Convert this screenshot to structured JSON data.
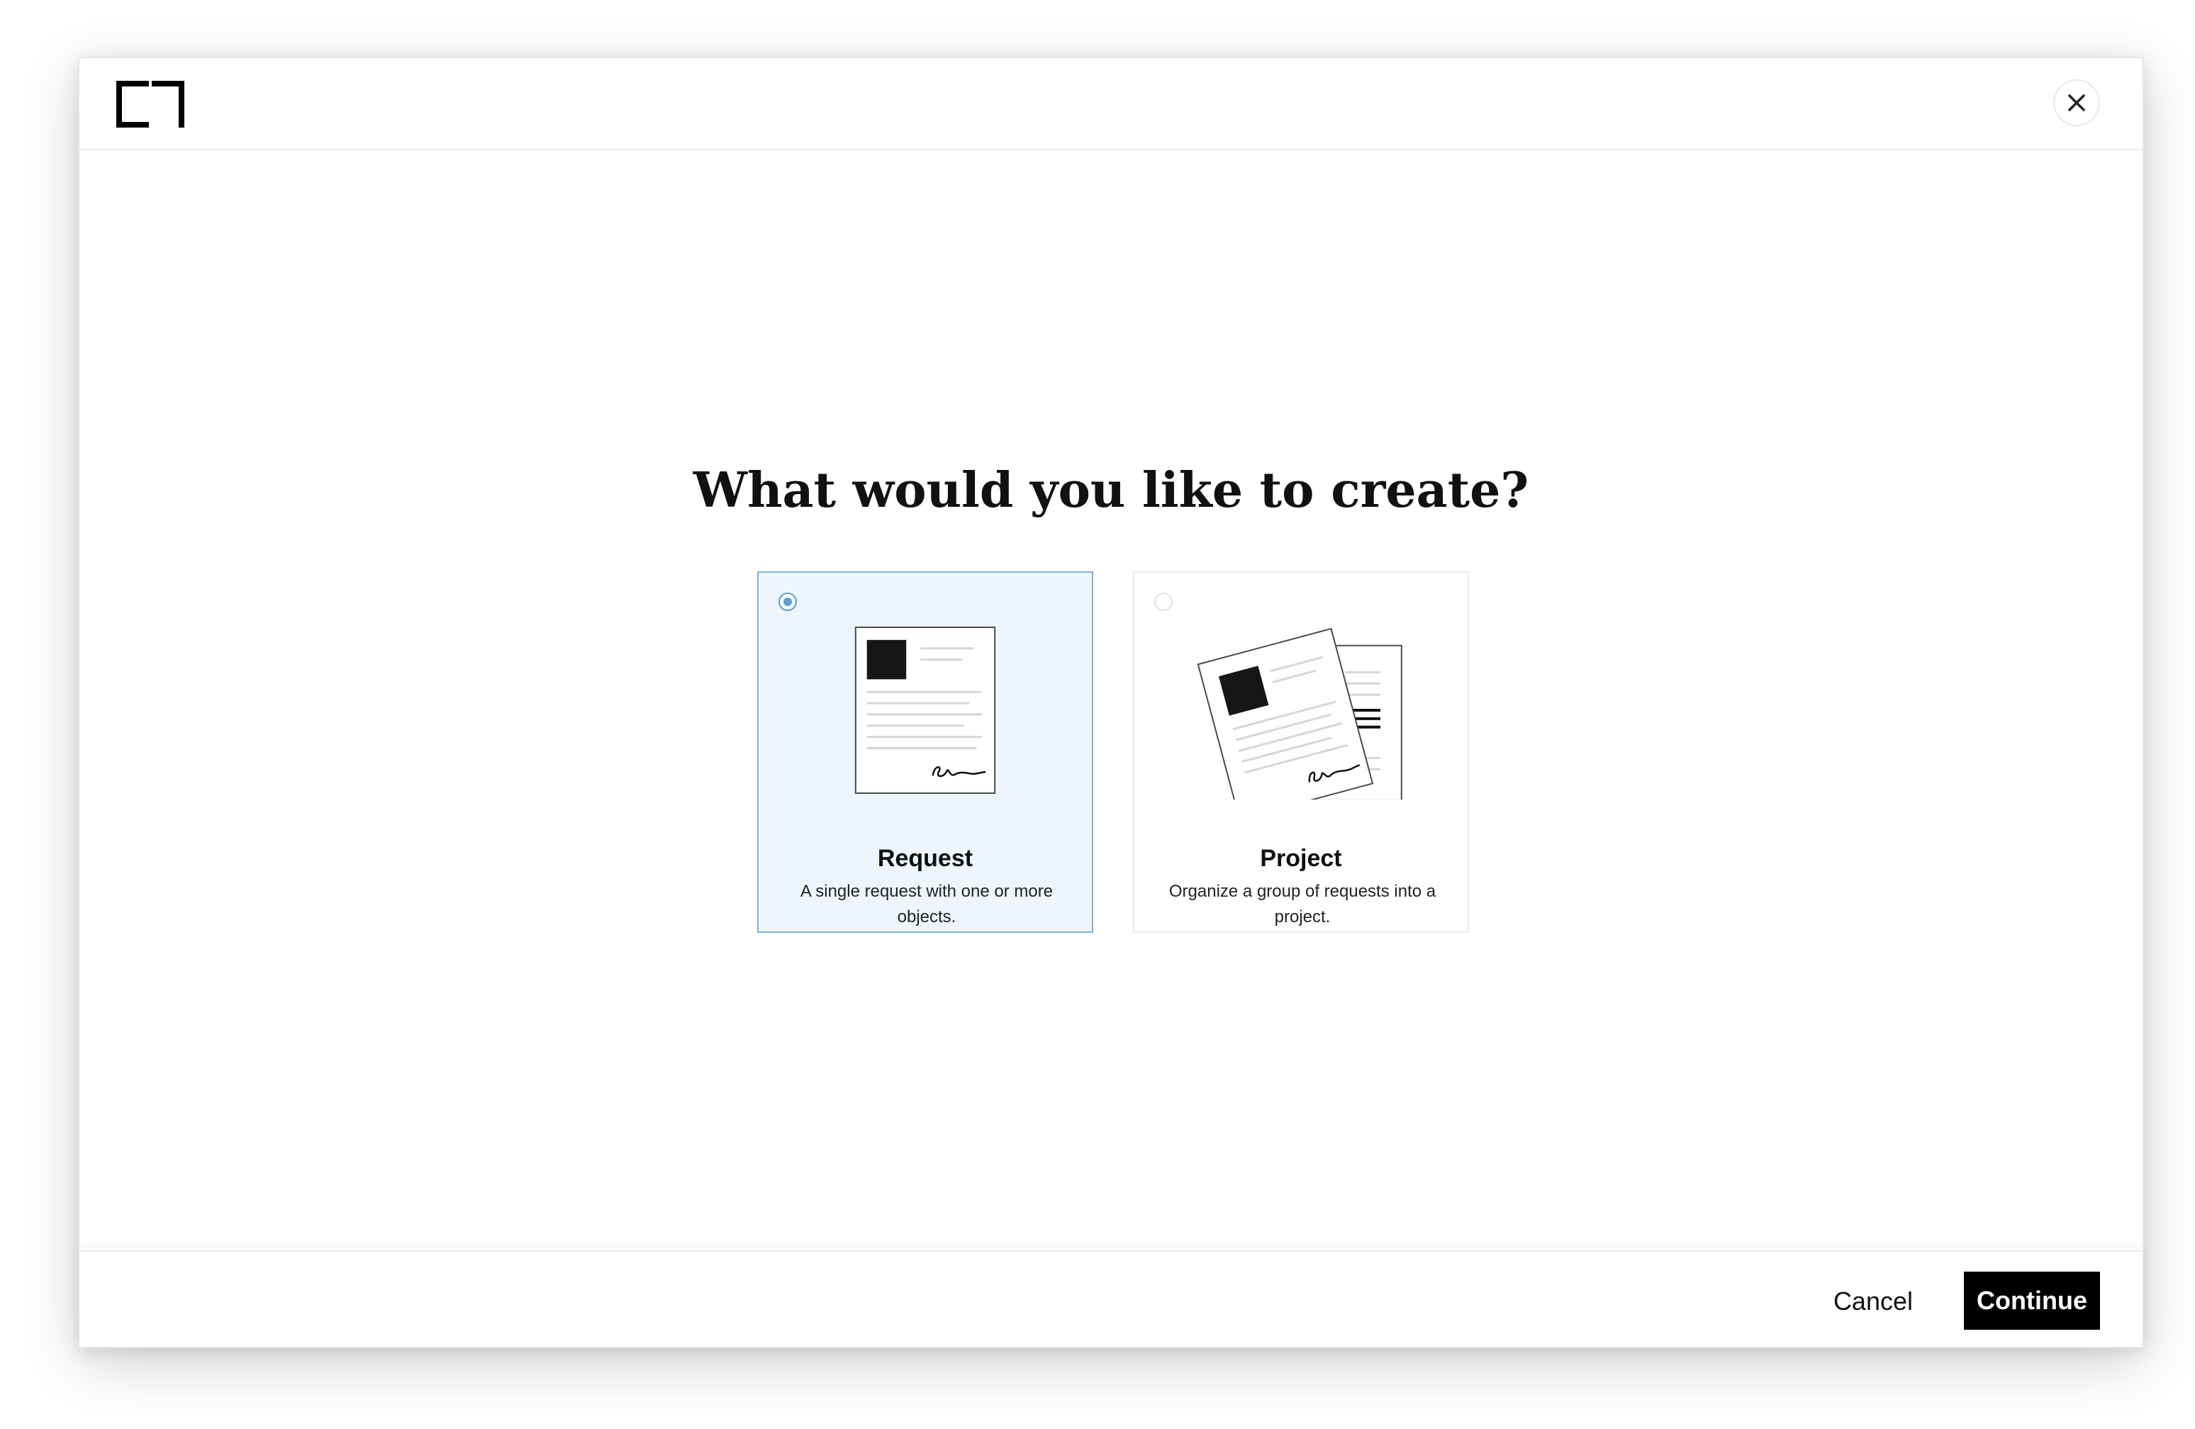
{
  "header": {
    "logo_icon": "bracket-logo-icon",
    "close_icon": "close-icon"
  },
  "main": {
    "title": "What would you like to create?",
    "options": [
      {
        "label": "Request",
        "description": "A single request with one or more objects.",
        "selected": true,
        "icon": "single-document-icon"
      },
      {
        "label": "Project",
        "description": "Organize a group of requests into a project.",
        "selected": false,
        "icon": "stacked-documents-icon"
      }
    ]
  },
  "footer": {
    "cancel_label": "Cancel",
    "continue_label": "Continue"
  },
  "colors": {
    "selected_background": "#eef5fc",
    "selected_border": "#7fb2d9",
    "radio_accent": "#5b9fd4",
    "primary_button": "#000000"
  }
}
